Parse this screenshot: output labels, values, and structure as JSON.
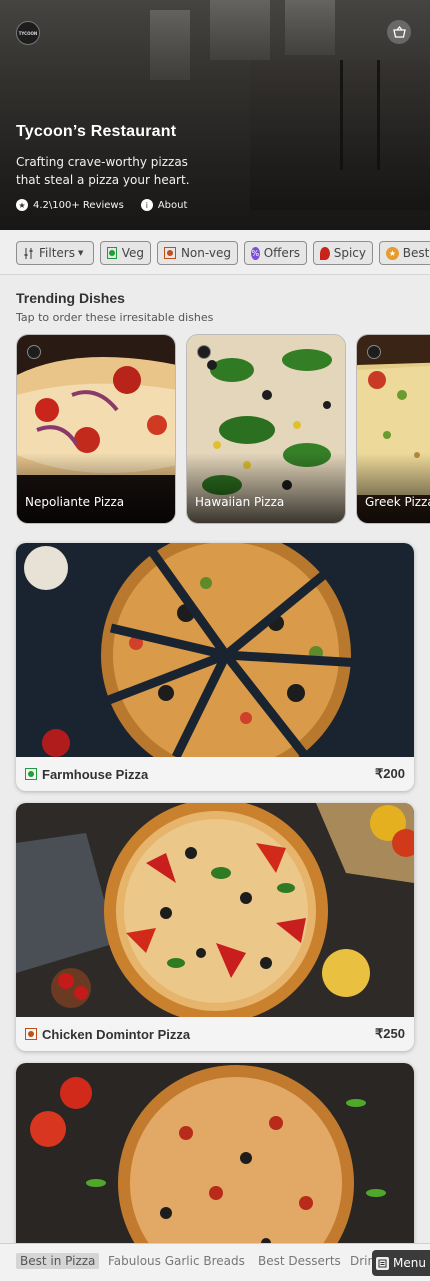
{
  "restaurant": {
    "logo_text": "TYCOON",
    "name": "Tycoon’s Restaurant",
    "tagline": "Crafting crave-worthy pizzas that steal a pizza your heart.",
    "rating_text": "4.2\\100+ Reviews",
    "about_label": "About"
  },
  "filters": [
    {
      "label": "Filters",
      "icon": "sliders-icon"
    },
    {
      "label": "Veg",
      "icon": "veg-icon"
    },
    {
      "label": "Non-veg",
      "icon": "nonveg-icon"
    },
    {
      "label": "Offers",
      "icon": "offer-icon"
    },
    {
      "label": "Spicy",
      "icon": "chili-icon"
    },
    {
      "label": "Bestseller",
      "icon": "badge-icon"
    }
  ],
  "trending": {
    "title": "Trending Dishes",
    "subtitle": "Tap to order these irresitable dishes",
    "items": [
      {
        "name": "Nepoliante Pizza"
      },
      {
        "name": "Hawaiian Pizza"
      },
      {
        "name": "Greek Pizza"
      }
    ]
  },
  "products": [
    {
      "name": "Farmhouse Pizza",
      "price": "₹200",
      "type": "veg"
    },
    {
      "name": "Chicken Domintor Pizza",
      "price": "₹250",
      "type": "non-veg"
    },
    {
      "name": "",
      "price": "",
      "type": ""
    }
  ],
  "bottom_nav": {
    "categories": [
      "Best in Pizza",
      "Fabulous Garlic Breads",
      "Best Desserts",
      "Drinks"
    ],
    "active": "Best in Pizza",
    "menu_label": "Menu"
  },
  "colors": {
    "veg": "#1f9d3a",
    "non_veg": "#c0501a",
    "offers": "#7b4fd8",
    "spicy": "#c8241b"
  }
}
